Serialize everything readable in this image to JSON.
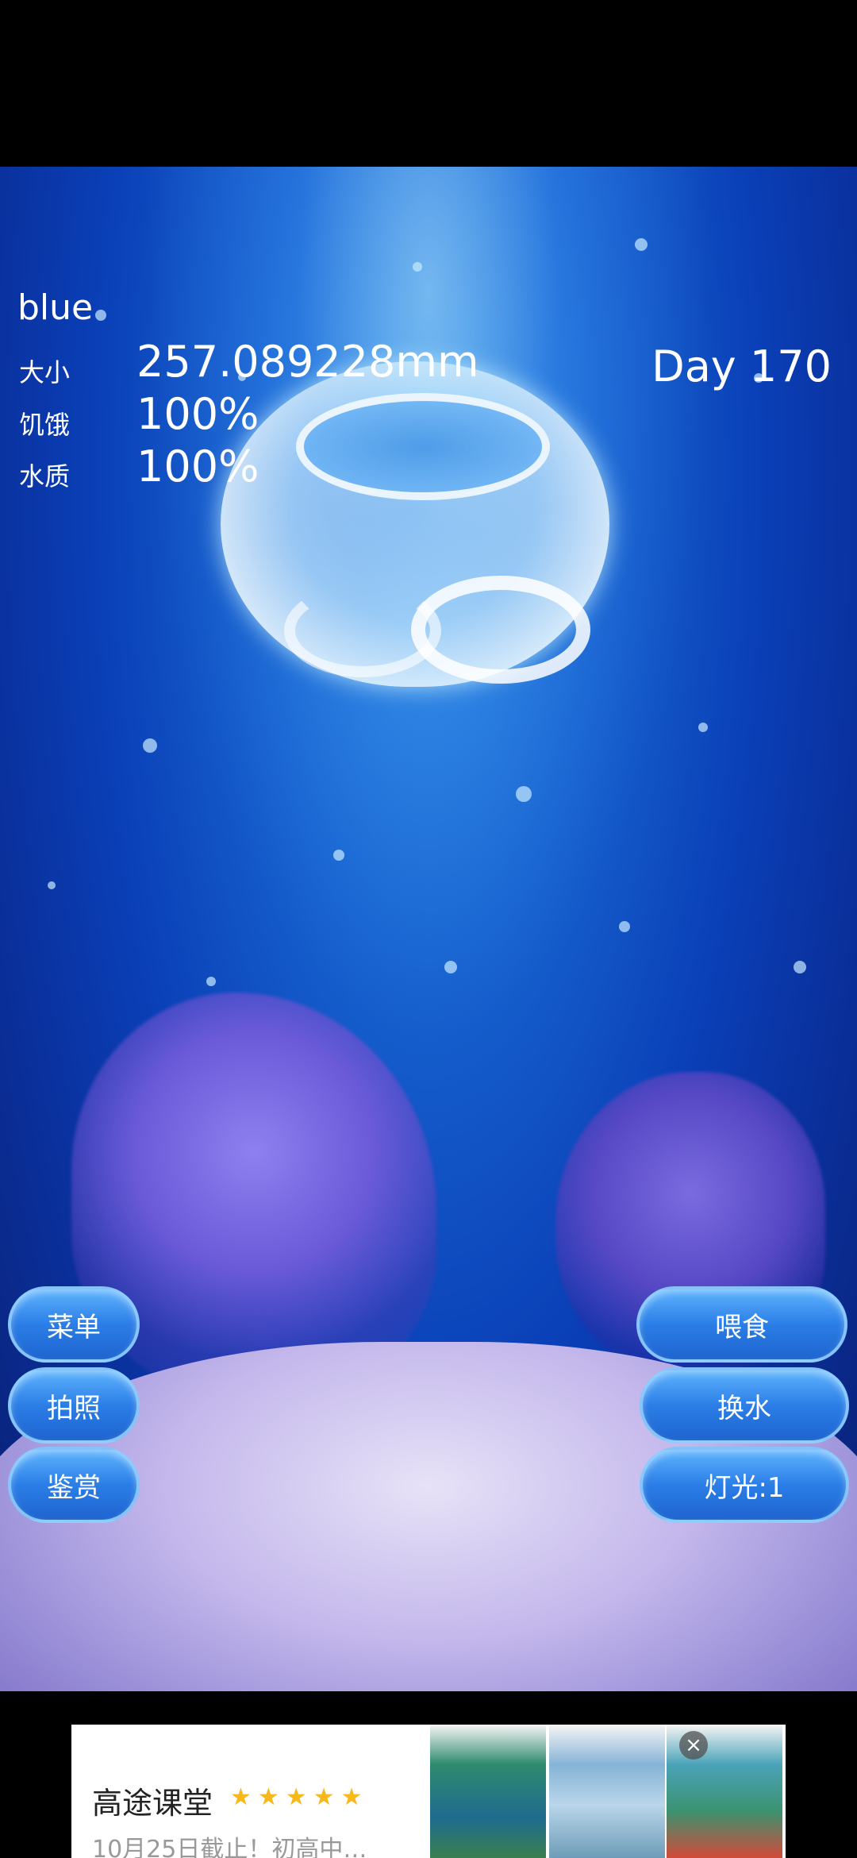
{
  "jellyfish": {
    "name": "blue",
    "stats": [
      {
        "label": "大小",
        "value": "257.089228mm"
      },
      {
        "label": "饥饿",
        "value": "100%"
      },
      {
        "label": "水质",
        "value": "100%"
      }
    ],
    "day": "Day 170"
  },
  "buttons": {
    "left": [
      "菜单",
      "拍照",
      "鉴赏"
    ],
    "right": [
      "喂食",
      "换水",
      "灯光:1"
    ]
  },
  "ad": {
    "title": "高途课堂",
    "stars": "★★★★★",
    "subtitle": "10月25日截止！初高中…",
    "close_symbol": "×"
  },
  "colors": {
    "water": "#0a3fb7",
    "button": "#2b7ee6",
    "star": "#f7b91a"
  }
}
